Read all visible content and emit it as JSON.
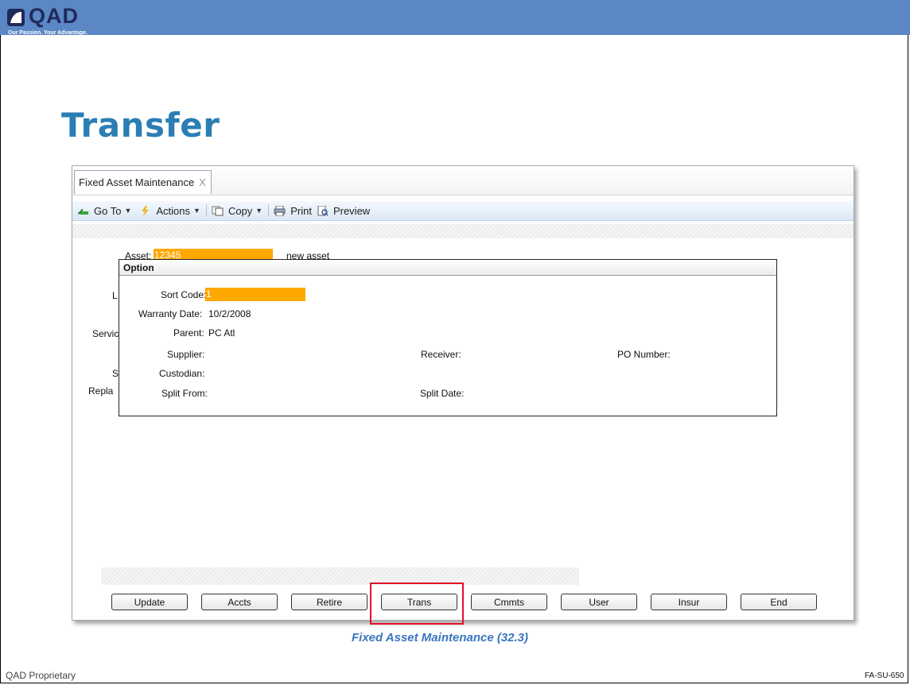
{
  "header": {
    "logo_text": "QAD",
    "tagline": "Our Passion. Your Advantage."
  },
  "slide": {
    "title": "Transfer",
    "caption": "Fixed Asset Maintenance (32.3)",
    "footer_left": "QAD Proprietary",
    "footer_right": "FA-SU-650"
  },
  "window": {
    "tab_label": "Fixed Asset Maintenance",
    "tab_close": "X",
    "toolbar": {
      "goto_label": "Go To",
      "actions_label": "Actions",
      "copy_label": "Copy",
      "print_label": "Print",
      "preview_label": "Preview"
    },
    "form": {
      "asset_label": "Asset:",
      "asset_value": "12345",
      "asset_desc": "new asset",
      "partial_labels": [
        "L",
        "Servic",
        "S",
        "Repla"
      ]
    },
    "dialog": {
      "title": "Option",
      "sort_code_label": "Sort Code:",
      "sort_code_value": "1",
      "warranty_label": "Warranty Date:",
      "warranty_value": "10/2/2008",
      "parent_label": "Parent:",
      "parent_value": "PC Atl",
      "supplier_label": "Supplier:",
      "receiver_label": "Receiver:",
      "po_label": "PO Number:",
      "custodian_label": "Custodian:",
      "split_from_label": "Split From:",
      "split_date_label": "Split Date:"
    },
    "buttons": {
      "update": "Update",
      "accts": "Accts",
      "retire": "Retire",
      "trans": "Trans",
      "cmmts": "Cmmts",
      "user": "User",
      "insur": "Insur",
      "end": "End"
    }
  },
  "colors": {
    "header": "#5b87c5",
    "title": "#2b7eb4",
    "field_highlight": "#ffa800",
    "callout": "#e3102a",
    "caption": "#3a76bf"
  }
}
